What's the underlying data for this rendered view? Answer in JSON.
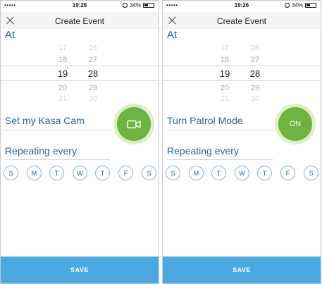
{
  "screens": [
    {
      "status": {
        "carrier": "•••••",
        "time": "19:26",
        "battery": "34%"
      },
      "header_title": "Create Event",
      "at_label": "At",
      "picker": {
        "hours_above": [
          "17",
          "18"
        ],
        "hour_selected": "19",
        "hours_below": [
          "20",
          "21"
        ],
        "minutes_above": [
          "26",
          "27"
        ],
        "minute_selected": "28",
        "minutes_below": [
          "29",
          "30"
        ]
      },
      "action_label": "Set my Kasa Cam",
      "action_button_text": "",
      "action_icon": "video-camera-icon",
      "repeat_label": "Repeating every",
      "days": [
        "S",
        "M",
        "T",
        "W",
        "T",
        "F",
        "S"
      ],
      "save_label": "SAVE"
    },
    {
      "status": {
        "carrier": "•••••",
        "time": "19:26",
        "battery": "34%"
      },
      "header_title": "Create Event",
      "at_label": "At",
      "picker": {
        "hours_above": [
          "17",
          "18"
        ],
        "hour_selected": "19",
        "hours_below": [
          "20",
          "21"
        ],
        "minutes_above": [
          "26",
          "27"
        ],
        "minute_selected": "28",
        "minutes_below": [
          "29",
          "30"
        ]
      },
      "action_label": "Turn Patrol Mode",
      "action_button_text": "ON",
      "repeat_label": "Repeating every",
      "days": [
        "S",
        "M",
        "T",
        "W",
        "T",
        "F",
        "S"
      ],
      "save_label": "SAVE"
    }
  ],
  "colors": {
    "accent_text": "#2f6788",
    "action_green": "#6db33f",
    "save_blue": "#4aa9e0"
  }
}
